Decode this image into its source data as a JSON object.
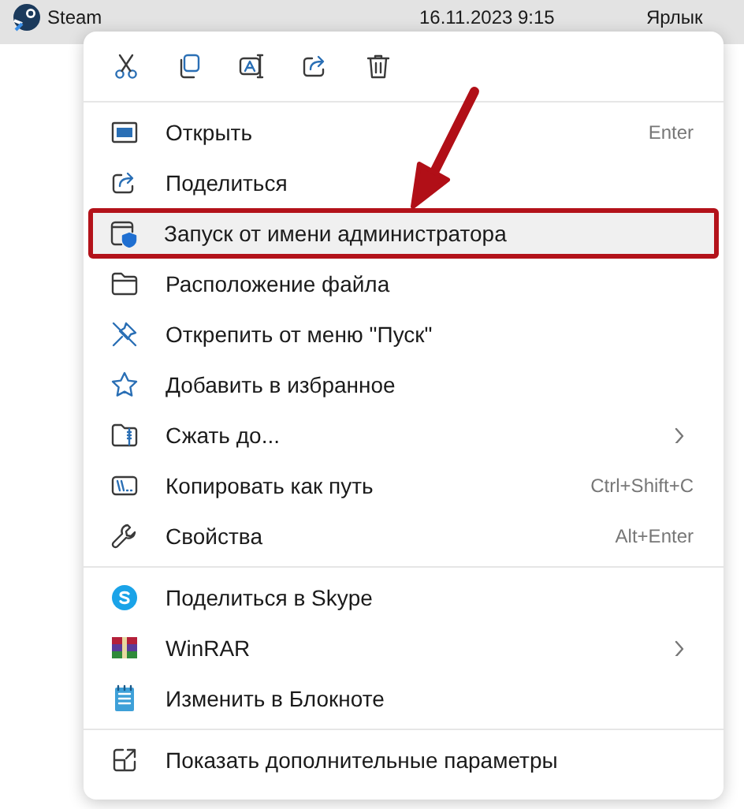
{
  "file_row": {
    "name": "Steam",
    "date": "16.11.2023 9:15",
    "type": "Ярлык"
  },
  "context_menu": {
    "sections": [
      [
        {
          "label": "Открыть",
          "shortcut": "Enter",
          "submenu": false,
          "selected": false
        },
        {
          "label": "Поделиться",
          "submenu": false,
          "selected": false
        },
        {
          "label": "Запуск от имени администратора",
          "submenu": false,
          "selected": true
        },
        {
          "label": "Расположение файла",
          "submenu": false,
          "selected": false
        },
        {
          "label": "Открепить от меню \"Пуск\"",
          "submenu": false,
          "selected": false
        },
        {
          "label": "Добавить в избранное",
          "submenu": false,
          "selected": false
        },
        {
          "label": "Сжать до...",
          "submenu": true,
          "selected": false
        },
        {
          "label": "Копировать как путь",
          "shortcut": "Ctrl+Shift+C",
          "submenu": false,
          "selected": false
        },
        {
          "label": "Свойства",
          "shortcut": "Alt+Enter",
          "submenu": false,
          "selected": false
        }
      ],
      [
        {
          "label": "Поделиться в Skype",
          "submenu": false,
          "selected": false
        },
        {
          "label": "WinRAR",
          "submenu": true,
          "selected": false
        },
        {
          "label": "Изменить в Блокноте",
          "submenu": false,
          "selected": false
        }
      ],
      [
        {
          "label": "Показать дополнительные параметры",
          "submenu": false,
          "selected": false
        }
      ]
    ]
  }
}
